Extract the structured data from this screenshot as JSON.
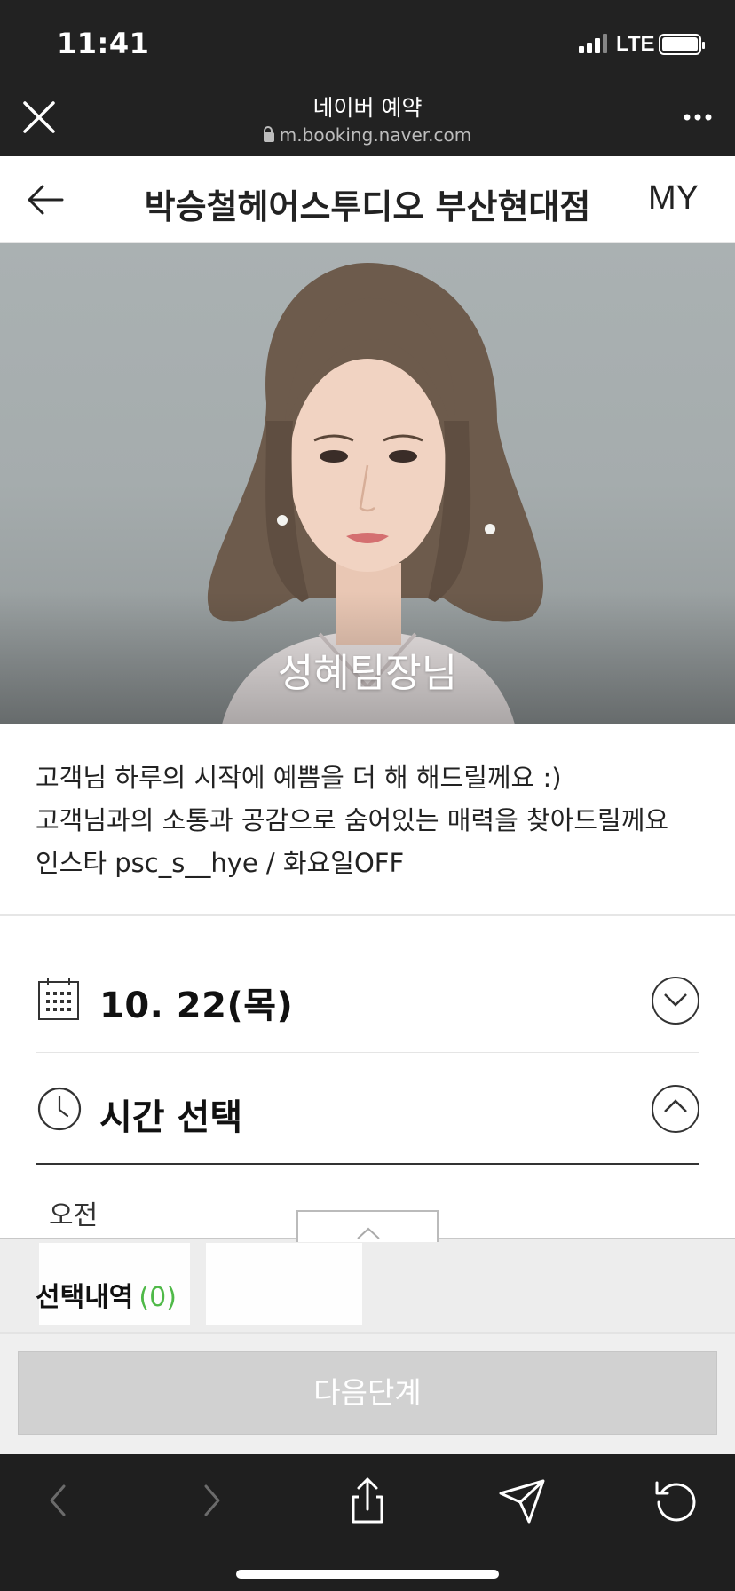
{
  "status_bar": {
    "time": "11:41",
    "network": "LTE",
    "icons": [
      "signal-icon",
      "battery-icon"
    ]
  },
  "browser": {
    "title": "네이버 예약",
    "url": "m.booking.naver.com",
    "icons": [
      "close-icon",
      "lock-icon",
      "more-icon"
    ]
  },
  "header": {
    "title": "박승철헤어스투디오 부산현대점",
    "my_label": "MY",
    "icons": [
      "back-arrow-icon"
    ]
  },
  "staff": {
    "name": "성혜팀장님"
  },
  "description": {
    "lines": [
      "고객님 하루의 시작에 예쁨을 더 해 해드릴께요 :)",
      "고객님과의 소통과 공감으로 숨어있는 매력을 찾아드릴께요",
      "인스타 psc_s__hye / 화요일OFF"
    ]
  },
  "date_row": {
    "label": "10. 22(목)",
    "icons": [
      "calendar-icon",
      "chevron-down-icon"
    ]
  },
  "time_row": {
    "label": "시간 선택",
    "icons": [
      "clock-icon",
      "chevron-up-icon"
    ]
  },
  "time_period": {
    "label": "오전"
  },
  "selection": {
    "label": "선택내역",
    "count": "(0)"
  },
  "next_button": {
    "label": "다음단계"
  },
  "toolbar": {
    "icons": [
      "back-icon",
      "forward-icon",
      "share-icon",
      "send-icon",
      "refresh-icon"
    ]
  },
  "colors": {
    "accent_green": "#4fb948",
    "dark_bar": "#222222",
    "disabled_button": "#d1d1d1"
  }
}
